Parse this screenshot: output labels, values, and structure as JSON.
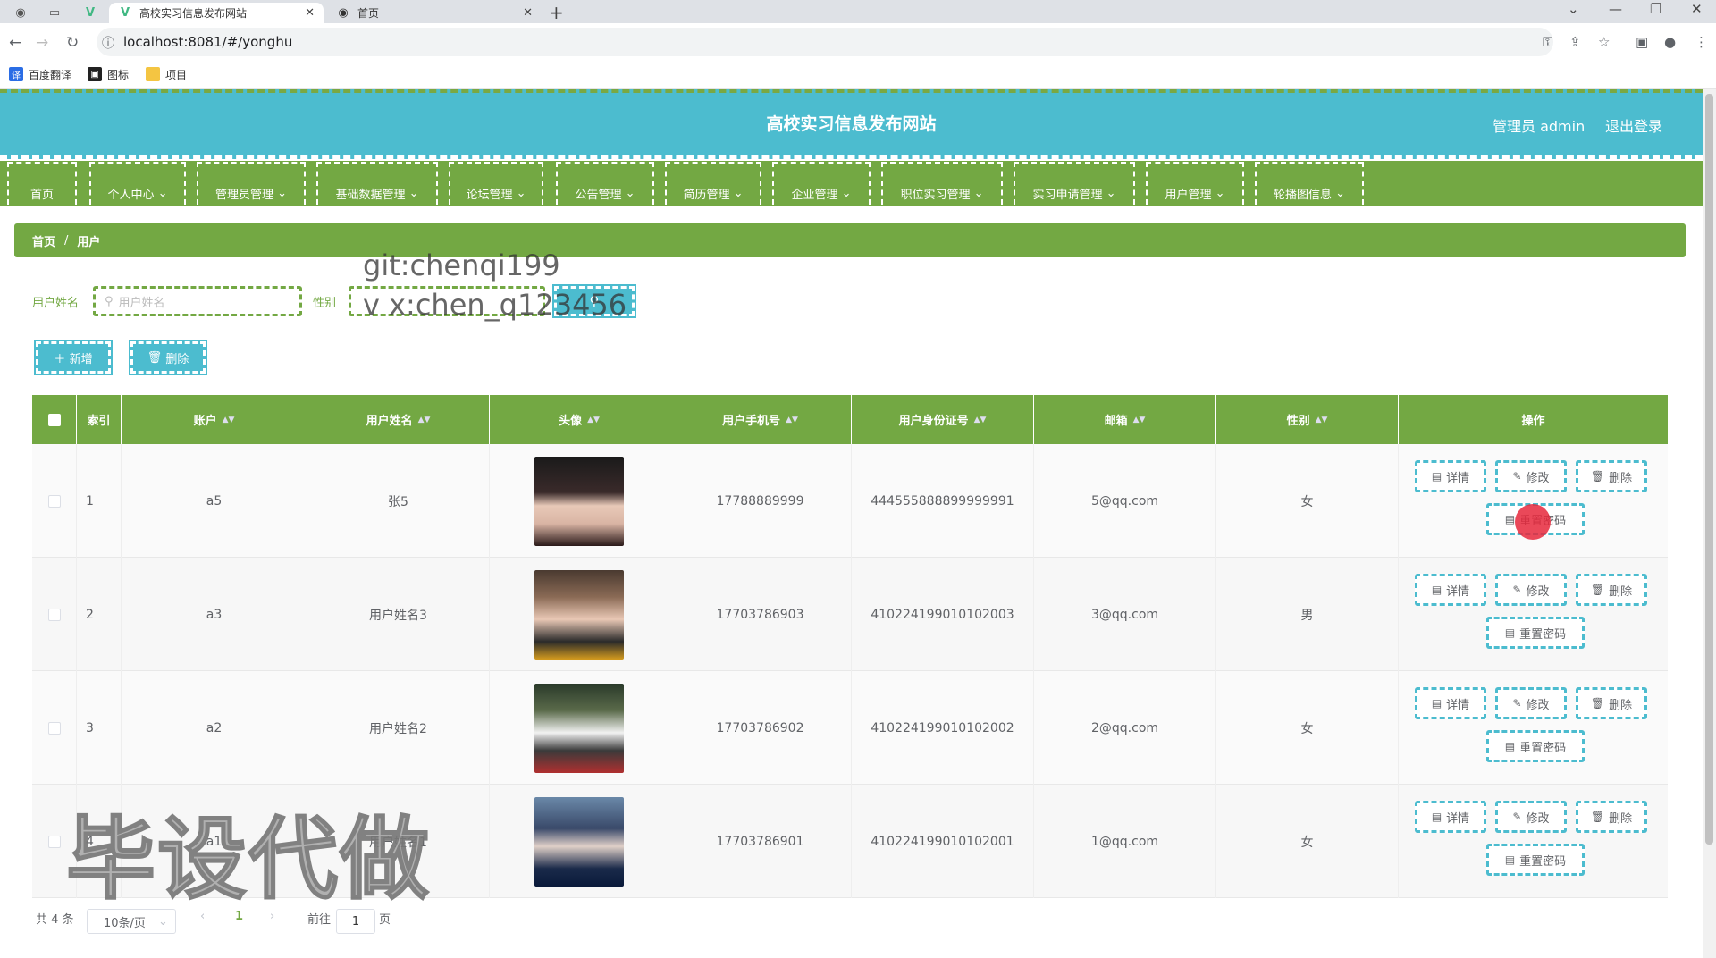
{
  "browser": {
    "tabs": [
      {
        "title": "高校实习信息发布网站",
        "icon": "vue-logo-icon"
      },
      {
        "title": "首页",
        "icon": "globe-icon"
      }
    ],
    "url": "localhost:8081/#/yonghu",
    "bookmarks": [
      "百度翻译",
      "图标",
      "项目"
    ]
  },
  "header": {
    "title": "高校实习信息发布网站",
    "user": "管理员 admin",
    "logout": "退出登录"
  },
  "menu": [
    "首页",
    "个人中心",
    "管理员管理",
    "基础数据管理",
    "论坛管理",
    "公告管理",
    "简历管理",
    "企业管理",
    "职位实习管理",
    "实习申请管理",
    "用户管理",
    "轮播图信息"
  ],
  "breadcrumb": {
    "home": "首页",
    "sep": "/",
    "current": "用户"
  },
  "search": {
    "name_label": "用户姓名",
    "name_placeholder": "用户姓名",
    "gender_label": "性别"
  },
  "actions": {
    "add": "新增",
    "delete": "删除"
  },
  "watermark": {
    "line1": "git:chenqi199",
    "line2": "v x:chen_q123456",
    "big": "毕设代做"
  },
  "table": {
    "headers": [
      "索引",
      "账户",
      "用户姓名",
      "头像",
      "用户手机号",
      "用户身份证号",
      "邮箱",
      "性别",
      "操作"
    ],
    "rows": [
      {
        "index": "1",
        "account": "a5",
        "name": "张5",
        "phone": "17788889999",
        "idcard": "444555888899999991",
        "email": "5@qq.com",
        "gender": "女"
      },
      {
        "index": "2",
        "account": "a3",
        "name": "用户姓名3",
        "phone": "17703786903",
        "idcard": "410224199010102003",
        "email": "3@qq.com",
        "gender": "男"
      },
      {
        "index": "3",
        "account": "a2",
        "name": "用户姓名2",
        "phone": "17703786902",
        "idcard": "410224199010102002",
        "email": "2@qq.com",
        "gender": "女"
      },
      {
        "index": "4",
        "account": "a1",
        "name": "用户姓名1",
        "phone": "17703786901",
        "idcard": "410224199010102001",
        "email": "1@qq.com",
        "gender": "女"
      }
    ],
    "ops": {
      "detail": "详情",
      "edit": "修改",
      "delete": "删除",
      "reset": "重置密码"
    }
  },
  "pagination": {
    "total": "共 4 条",
    "page_size": "10条/页",
    "current": "1",
    "goto": "前往",
    "goto_value": "1",
    "page_unit": "页"
  },
  "colors": {
    "green": "#73a843",
    "teal": "#4cbccf"
  }
}
